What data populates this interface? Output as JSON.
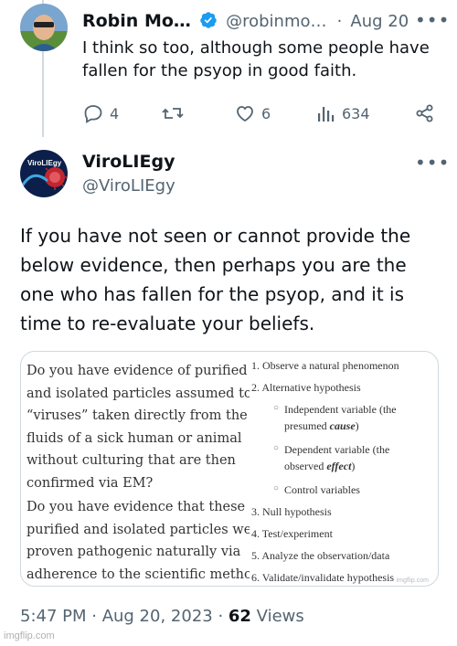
{
  "reply": {
    "name": "Robin Mo…",
    "handle": "@robinmo…",
    "separator": "·",
    "date": "Aug 20",
    "text": "I think so too, although some people have fallen for the psyop  in good faith.",
    "actions": {
      "replies": "4",
      "likes": "6",
      "views": "634"
    },
    "icons": [
      "reply-icon",
      "retweet-icon",
      "like-icon",
      "views-icon",
      "share-icon",
      "verified-badge-icon",
      "more-icon"
    ],
    "colors": {
      "verified": "#1d9bf0",
      "text": "#0f1419",
      "muted": "#536471"
    }
  },
  "tweet": {
    "name": "ViroLIEgy",
    "handle": "@ViroLIEgy",
    "avatar_text": "ViroLIEgy",
    "text": "If you have not seen or cannot provide the below evidence, then perhaps you are the one who has fallen for the psyop, and it is time to re-evaluate your beliefs.",
    "image": {
      "question_lines": [
        "Do you have evidence of purified",
        "and isolated particles assumed to",
        "“viruses” taken directly from the",
        "fluids of a sick human or animal",
        "without culturing that are then",
        "confirmed via EM?",
        "Do you have evidence that these",
        "purified and isolated particles were",
        "proven pathogenic naturally via",
        "adherence to the scientific method"
      ],
      "steps": {
        "s1": "1.  Observe a natural phenomenon",
        "s2": "2.  Alternative hypothesis",
        "s2a_1": "Independent variable (the",
        "s2a_2": "presumed ",
        "s2a_3": "cause",
        "s2a_4": ")",
        "s2b_1": "Dependent variable (the",
        "s2b_2": "observed ",
        "s2b_3": "effect",
        "s2b_4": ")",
        "s2c": "Control variables",
        "s3": "3.  Null hypothesis",
        "s4": "4.  Test/experiment",
        "s5": "5.  Analyze the observation/data",
        "s6": "6.  Validate/invalidate hypothesis",
        "bullet": "○"
      },
      "watermark": "imgflip.com"
    },
    "footer": {
      "time": "5:47 PM · Aug 20, 2023 · ",
      "views_count": "62",
      "views_label": " Views"
    }
  },
  "watermark": "imgflip.com"
}
